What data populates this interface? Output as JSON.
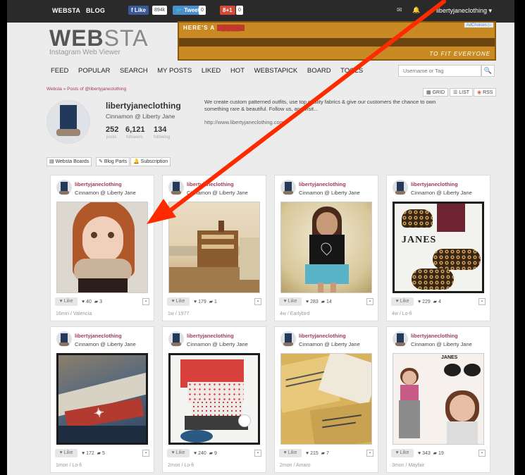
{
  "topbar": {
    "nav": [
      "WEBSTA",
      "BLOG"
    ],
    "like_label": "Like",
    "like_count": "894k",
    "tweet_label": "Tweet",
    "tweet_count": "0",
    "gplus_label": "8+1",
    "gplus_count": "0",
    "user": "libertyjaneclothing ▾"
  },
  "logo": {
    "main": "WEB",
    "main_light": "STA",
    "tagline": "Instagram Web Viewer"
  },
  "ad": {
    "line1": "HERE'S A",
    "line2": "TO FIT EVERYONE",
    "choice": "AdChoices ▷"
  },
  "nav": [
    "FEED",
    "POPULAR",
    "SEARCH",
    "MY POSTS",
    "LIKED",
    "HOT",
    "WEBSTAPICK",
    "BOARD",
    "TOOLS"
  ],
  "search": {
    "placeholder": "Username or Tag"
  },
  "breadcrumb": "Websta » Posts of @libertyjaneclothing",
  "views": {
    "grid": "GRID",
    "list": "LIST",
    "rss": "RSS"
  },
  "profile": {
    "username": "libertyjaneclothing",
    "name": "Cinnamon @ Liberty Jane",
    "posts": "252",
    "posts_label": "posts",
    "followers": "6,121",
    "followers_label": "followers",
    "following": "134",
    "following_label": "following",
    "bio": "We create custom patterned outfits, use top quality fabrics & give our customers the chance to own something rare & beautiful. Follow us, and visit...",
    "url": "http://www.libertyjaneclothing.com/"
  },
  "pills": [
    "Websta Boards",
    "Blog Parts",
    "Subscription"
  ],
  "card_user": "libertyjaneclothing",
  "card_name": "Cinnamon @ Liberty Jane",
  "like_label": "Like",
  "posts": [
    {
      "likes": "40",
      "comments": "3",
      "meta": "16min / Valencia"
    },
    {
      "likes": "179",
      "comments": "1",
      "meta": "1w / 1977"
    },
    {
      "likes": "283",
      "comments": "14",
      "meta": "4w / Earlybird"
    },
    {
      "likes": "229",
      "comments": "4",
      "meta": "4w / Lo-fi",
      "caption": "JANES"
    },
    {
      "likes": "172",
      "comments": "5",
      "meta": "1mon / Lo-fi"
    },
    {
      "likes": "240",
      "comments": "9",
      "meta": "2mon / Lo-fi"
    },
    {
      "likes": "215",
      "comments": "7",
      "meta": "2mon / Amaro"
    },
    {
      "likes": "343",
      "comments": "19",
      "meta": "3mon / Mayfair",
      "caption": "JANES"
    }
  ],
  "colors": {
    "accent": "#a23b5a",
    "arrow": "#ff2a00",
    "topbar": "#2a2a2a"
  }
}
